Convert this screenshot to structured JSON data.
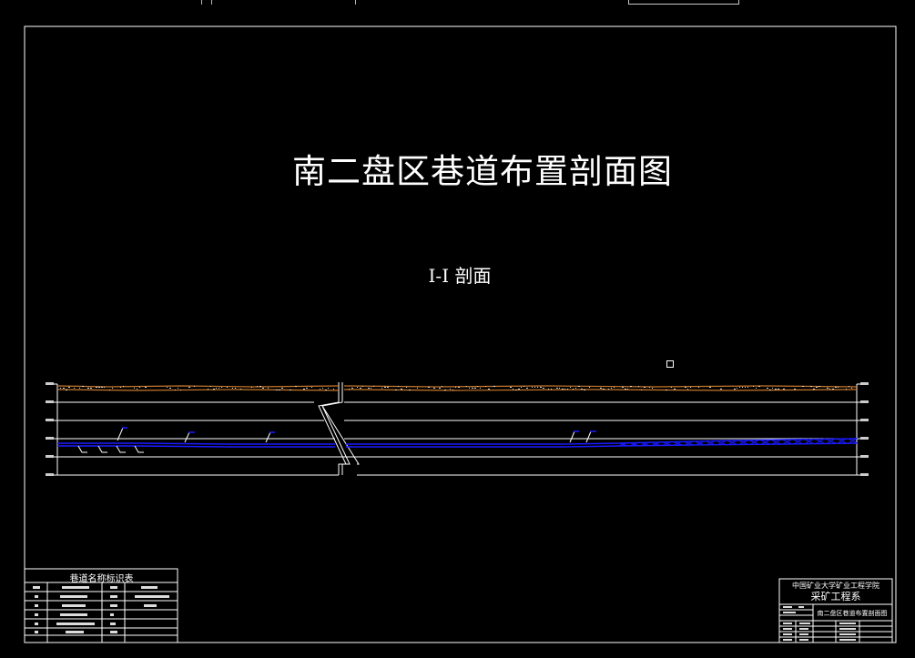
{
  "drawing": {
    "title": "南二盘区巷道布置剖面图",
    "section_label": "I-I 剖面"
  },
  "legend": {
    "title": "巷道名称标识表"
  },
  "title_block": {
    "school": "中国矿业大学矿业工程学院",
    "department": "采矿工程系",
    "drawing_name": "南二盘区巷道布置剖面图"
  },
  "colors": {
    "background": "#000000",
    "lines": "#ffffff",
    "seam": "#1a1aff",
    "surface": "#c8782c"
  }
}
